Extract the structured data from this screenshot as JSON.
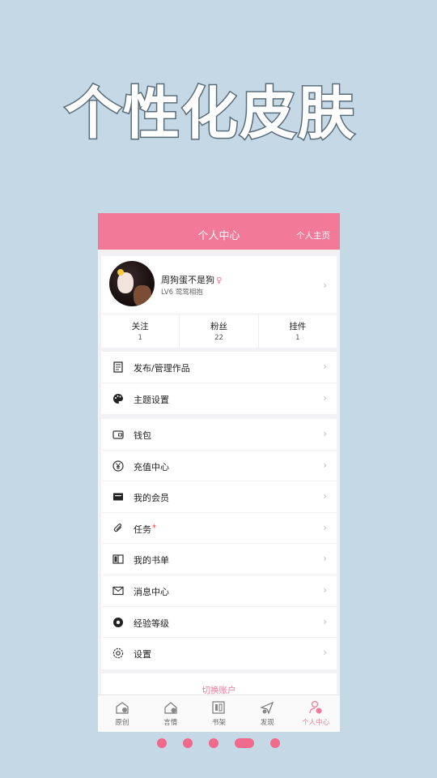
{
  "promo": {
    "title": "个性化皮肤"
  },
  "header": {
    "title": "个人中心",
    "home_link": "个人主页"
  },
  "profile": {
    "username": "周狗蛋不是狗",
    "gender_symbol": "♀",
    "level": "LV6 莺莺相抱",
    "stats": [
      {
        "label": "关注",
        "value": "1"
      },
      {
        "label": "粉丝",
        "value": "22"
      },
      {
        "label": "挂件",
        "value": "1"
      }
    ]
  },
  "menu_group_1": [
    {
      "label": "发布/管理作品",
      "icon": "document-icon"
    },
    {
      "label": "主题设置",
      "icon": "palette-icon"
    }
  ],
  "menu_group_2": [
    {
      "label": "钱包",
      "icon": "wallet-icon"
    },
    {
      "label": "充值中心",
      "icon": "yen-icon"
    },
    {
      "label": "我的会员",
      "icon": "vip-card-icon"
    },
    {
      "label": "任务",
      "icon": "paperclip-icon",
      "badge": "*"
    },
    {
      "label": "我的书单",
      "icon": "book-icon"
    },
    {
      "label": "消息中心",
      "icon": "mail-icon"
    },
    {
      "label": "经验等级",
      "icon": "level-icon"
    },
    {
      "label": "设置",
      "icon": "gear-icon"
    }
  ],
  "switch_account": "切换账户",
  "tabs": [
    {
      "label": "原创",
      "icon": "original-icon",
      "active": false
    },
    {
      "label": "言情",
      "icon": "romance-icon",
      "active": false
    },
    {
      "label": "书架",
      "icon": "bookshelf-icon",
      "active": false
    },
    {
      "label": "发现",
      "icon": "discover-icon",
      "active": false
    },
    {
      "label": "个人中心",
      "icon": "profile-icon",
      "active": true
    }
  ],
  "colors": {
    "accent": "#f27998",
    "background": "#c5d8e6"
  },
  "pager": {
    "total": 5,
    "current": 4
  }
}
